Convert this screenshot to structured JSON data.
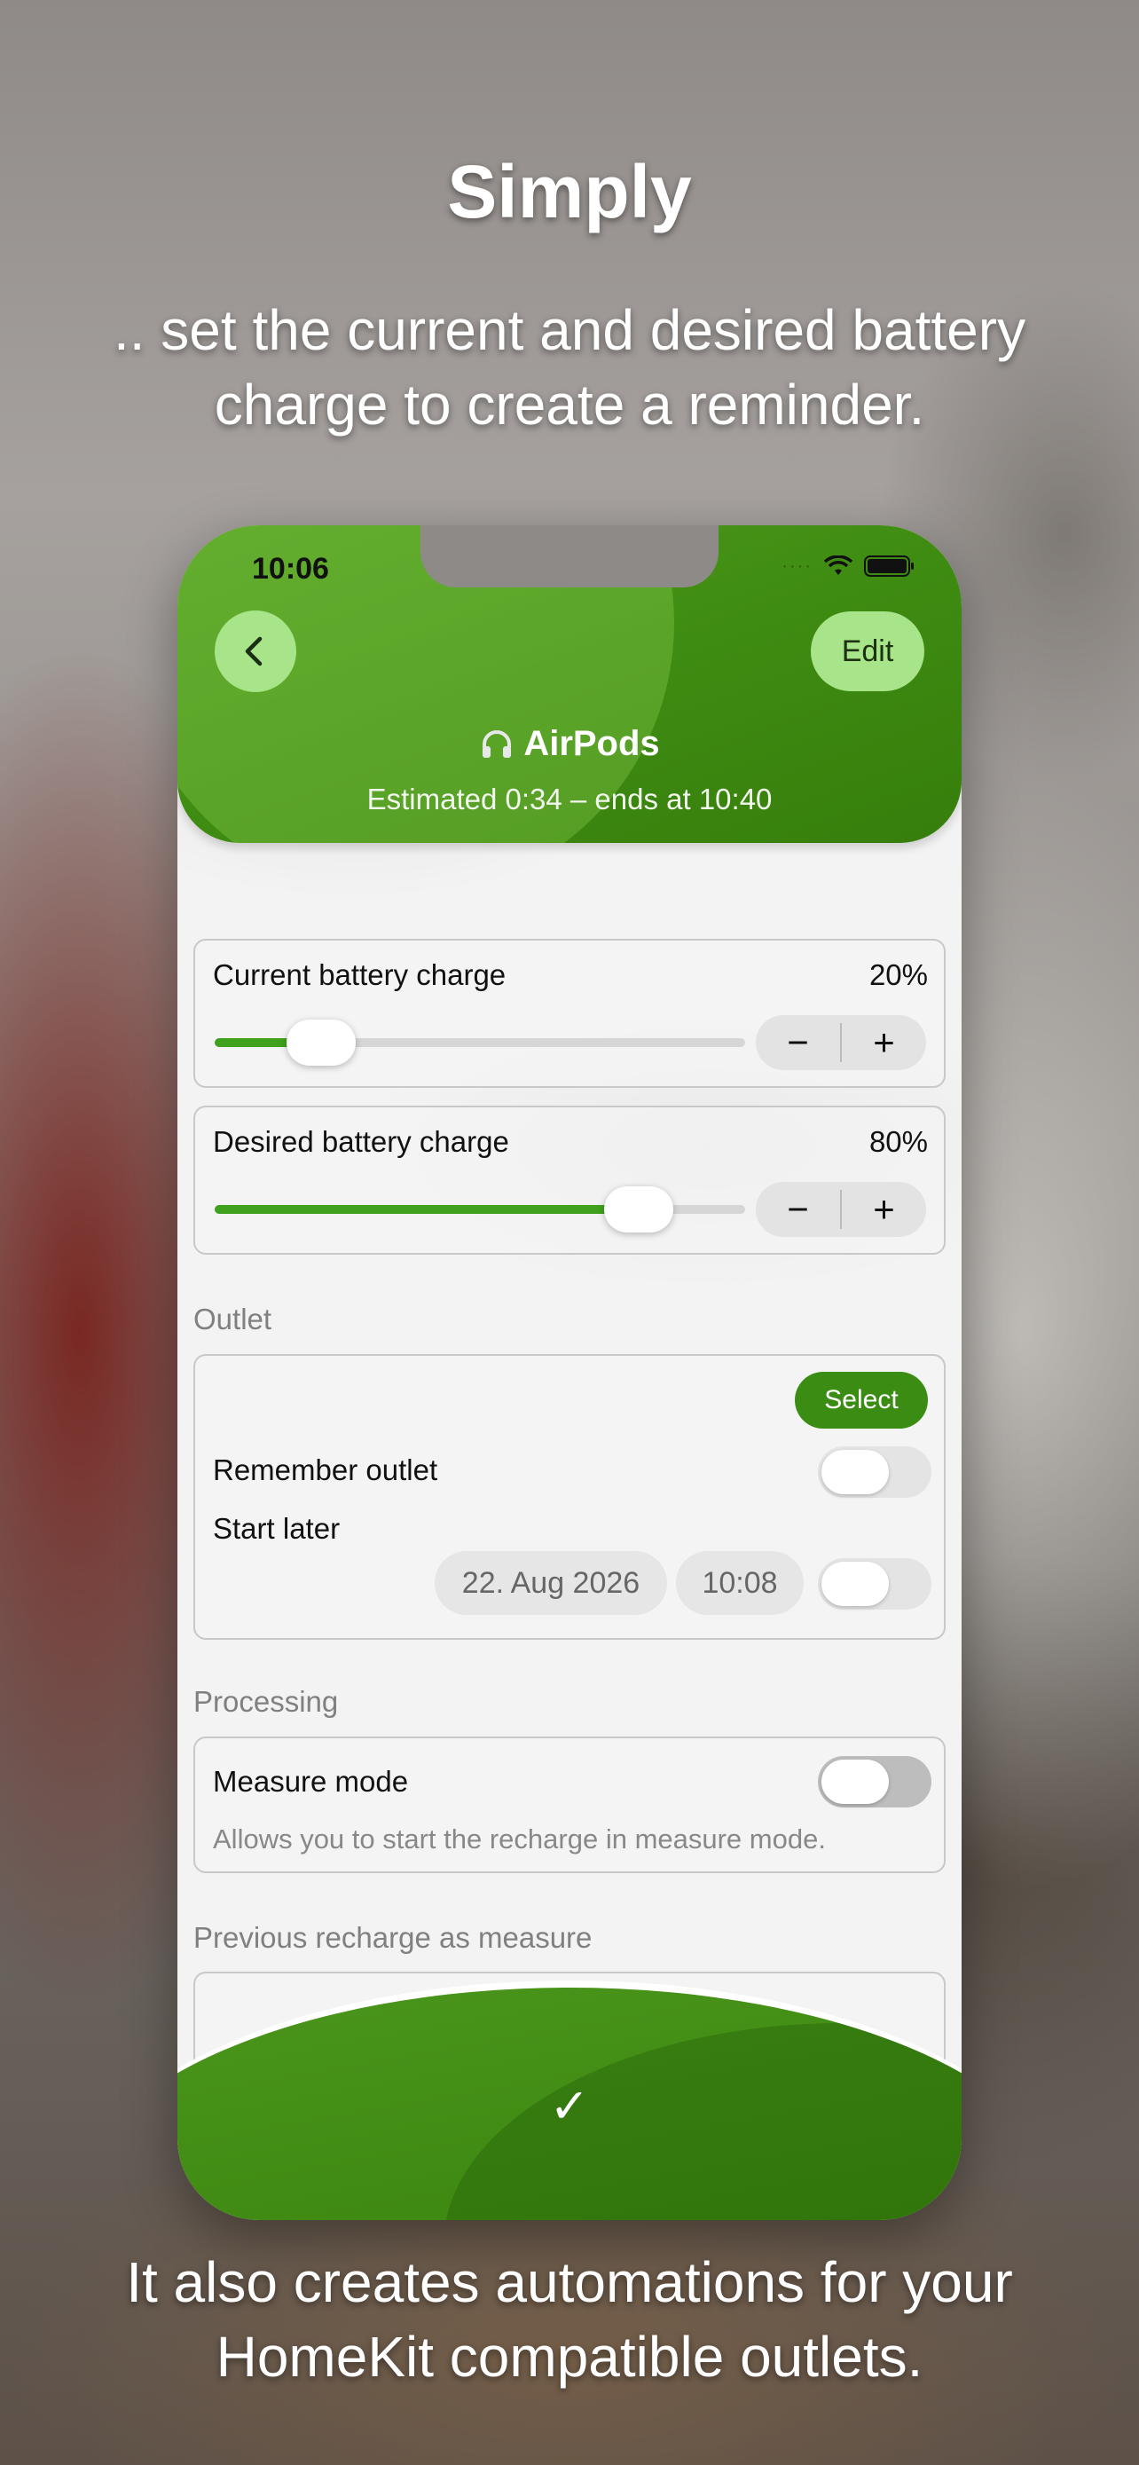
{
  "headline": {
    "title": "Simply",
    "subtitle": ".. set the current and desired battery charge to create a reminder.",
    "footer": "It also creates automations for your HomeKit compatible outlets."
  },
  "status_bar": {
    "time": "10:06"
  },
  "header": {
    "back_icon": "chevron-left-icon",
    "edit_label": "Edit",
    "device_icon": "headphones-icon",
    "device_name": "AirPods",
    "estimate": "Estimated 0:34 – ends at 10:40"
  },
  "current_charge": {
    "label": "Current battery charge",
    "value": "20%",
    "level": 0.2,
    "minus": "−",
    "plus": "+"
  },
  "desired_charge": {
    "label": "Desired battery charge",
    "value": "80%",
    "level": 0.8,
    "minus": "−",
    "plus": "+"
  },
  "outlet": {
    "section": "Outlet",
    "select_label": "Select",
    "remember_label": "Remember outlet",
    "start_later_label": "Start later",
    "date": "22. Aug 2026",
    "time": "10:08"
  },
  "processing": {
    "section": "Processing",
    "measure_label": "Measure mode",
    "measure_hint": "Allows you to start the recharge in measure mode."
  },
  "previous": {
    "section": "Previous recharge as measure"
  },
  "footer": {
    "confirm_icon": "checkmark-icon",
    "confirm_glyph": "✓"
  },
  "colors": {
    "accent": "#3a8d12",
    "accent_light": "#a8e489"
  }
}
